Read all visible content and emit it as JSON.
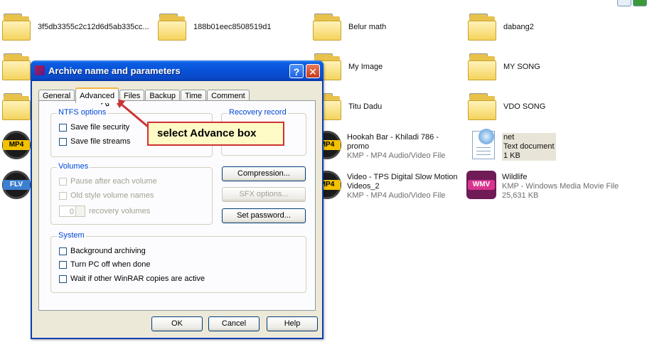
{
  "window_controls": {
    "restore_icon": "restore-icon",
    "ok_icon": "green-check-icon"
  },
  "files": [
    {
      "name": "3f5db3355c2c12d6d5ab335cc...",
      "icon": "folder-icon"
    },
    {
      "name": "188b01eec8508519d1",
      "icon": "folder-icon"
    },
    {
      "name": "Belur math",
      "icon": "folder-icon"
    },
    {
      "name": "dabang2",
      "icon": "folder-icon"
    },
    {
      "name": "My Image",
      "icon": "folder-icon"
    },
    {
      "name": "MY SONG",
      "icon": "folder-icon"
    },
    {
      "name": "Titu Dadu",
      "icon": "folder-icon"
    },
    {
      "name": "VDO SONG",
      "icon": "folder-icon"
    },
    {
      "name_line1": "Hookah Bar - Khiladi 786  -",
      "name_line2": "promo",
      "type": "KMP - MP4 Audio/Video File",
      "icon": "mp4-icon",
      "badge": "MP4"
    },
    {
      "name": "net",
      "type": "Text document",
      "size": "1 KB",
      "icon": "text-document-icon"
    },
    {
      "name_line1": "Video - TPS Digital Slow Motion",
      "name_line2": "Videos_2",
      "type": "KMP - MP4 Audio/Video File",
      "icon": "mp4-icon",
      "badge": "MP4"
    },
    {
      "name": "Wildlife",
      "type": "KMP - Windows Media Movie File",
      "size": "25,631 KB",
      "icon": "wmv-icon",
      "badge": "WMV"
    }
  ],
  "left_icons": [
    {
      "badge": "MP4"
    },
    {
      "badge": "FLV"
    }
  ],
  "dialog": {
    "title": "Archive name and parameters",
    "help_label": "?",
    "close_label": "✕",
    "tabs": [
      "General",
      "Advanced",
      "Files",
      "Backup",
      "Time",
      "Comment"
    ],
    "active_tab": "Advanced",
    "ntfs": {
      "title": "NTFS options",
      "save_security": "Save file security",
      "save_streams": "Save file streams"
    },
    "recovery": {
      "title": "Recovery record"
    },
    "volumes": {
      "title": "Volumes",
      "pause": "Pause after each volume",
      "old_style": "Old style volume names",
      "recovery_value": "0",
      "recovery_label": "recovery volumes"
    },
    "buttons": {
      "compression": "Compression...",
      "sfx": "SFX options...",
      "password": "Set password..."
    },
    "system": {
      "title": "System",
      "background": "Background archiving",
      "turn_off": "Turn PC off when done",
      "wait": "Wait if other WinRAR copies are active"
    },
    "footer": {
      "ok": "OK",
      "cancel": "Cancel",
      "help": "Help"
    }
  },
  "annotation": {
    "text": "select Advance box",
    "color": "#cc3333"
  }
}
